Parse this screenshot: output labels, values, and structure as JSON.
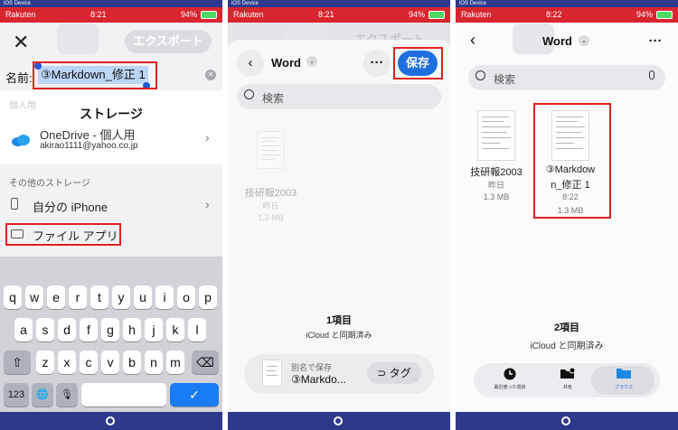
{
  "status": {
    "device": "iOS Device",
    "carrier": "Rakuten",
    "battery": "94%",
    "times": [
      "8:21",
      "8:21",
      "8:22"
    ]
  },
  "panel1": {
    "export_label": "エクスポート",
    "name_label": "名前:",
    "name_value": "③Markdown_修正 1",
    "ghost_text": "個人用",
    "storage_heading": "ストレージ",
    "onedrive_label": "OneDrive - 個人用",
    "onedrive_email": "akirao1111@yahoo.co.jp",
    "other_storage": "その他のストレージ",
    "iphone_label": "自分の iPhone",
    "files_app_label": "ファイル アプリ",
    "keyboard": {
      "row1": [
        "q",
        "w",
        "e",
        "r",
        "t",
        "y",
        "u",
        "i",
        "o",
        "p"
      ],
      "row2": [
        "a",
        "s",
        "d",
        "f",
        "g",
        "h",
        "j",
        "k",
        "l"
      ],
      "row3": [
        "z",
        "x",
        "c",
        "v",
        "b",
        "n",
        "m"
      ],
      "numbers_key": "123",
      "shift_key": "⇧",
      "delete_key": "⌫",
      "globe_key": "🌐",
      "mic_key": "🎙",
      "return_key": "✓"
    }
  },
  "panel2": {
    "export_label": "エクスポート",
    "folder_title": "Word",
    "save_label": "保存",
    "search_placeholder": "検索",
    "file": {
      "name": "技研報2003",
      "date": "昨日",
      "size": "1.3 MB"
    },
    "item_count": "1項目",
    "sync_status": "iCloud と同期済み",
    "save_as_label": "別名で保存",
    "save_as_value": "③Markdo...",
    "tag_label": "タグ"
  },
  "panel3": {
    "folder_title": "Word",
    "search_placeholder": "検索",
    "files": [
      {
        "name": "技研報2003",
        "date": "昨日",
        "size": "1.3 MB"
      },
      {
        "name_line1": "③Markdow",
        "name_line2": "n_修正 1",
        "date": "8:22",
        "size": "1.3 MB"
      }
    ],
    "item_count": "2項目",
    "sync_status": "iCloud と同期済み",
    "tabs": [
      {
        "label": "最近使った項目",
        "icon": "clock-icon"
      },
      {
        "label": "共有",
        "icon": "shared-folder-icon"
      },
      {
        "label": "ブラウズ",
        "icon": "folder-icon"
      }
    ]
  },
  "colors": {
    "status_bar": "#d8262f",
    "device_bar": "#2d3a8c",
    "accent_blue": "#1e6ee0",
    "highlight_red": "#e02020"
  }
}
